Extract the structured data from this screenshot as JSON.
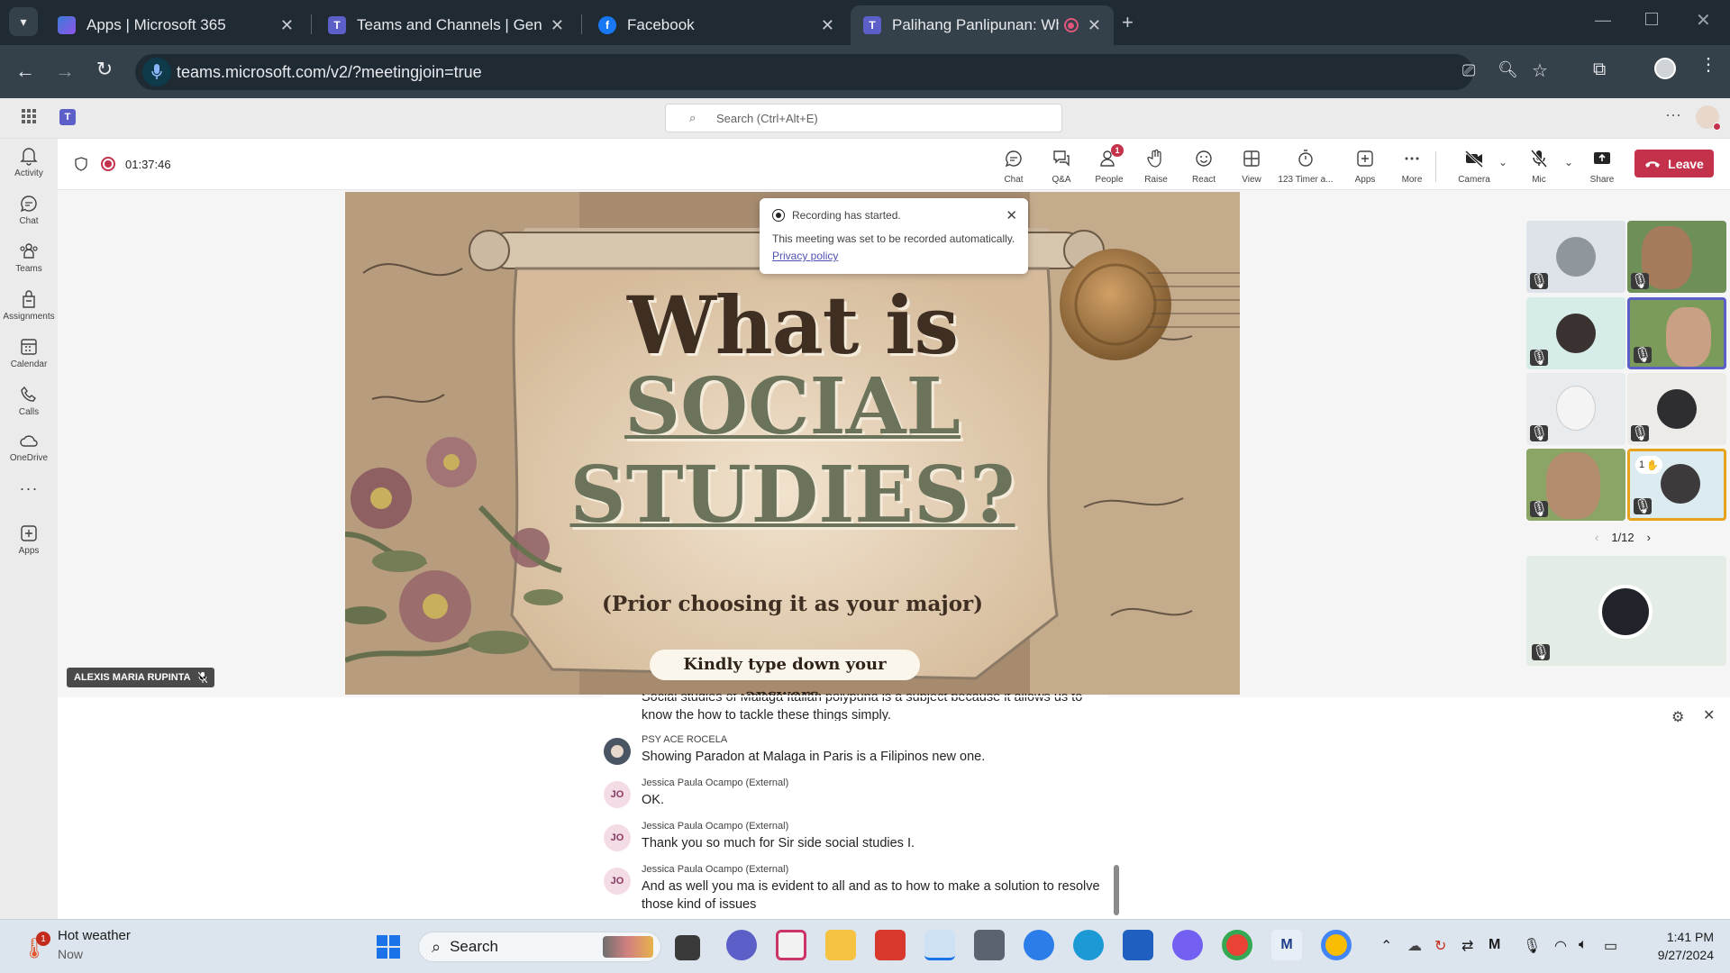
{
  "browser": {
    "tabs": [
      {
        "title": "Apps | Microsoft 365",
        "icon": "microsoft365-icon"
      },
      {
        "title": "Teams and Channels | General |",
        "icon": "teams-icon"
      },
      {
        "title": "Facebook",
        "icon": "facebook-icon"
      },
      {
        "title": "Palihang Panlipunan: Why S",
        "icon": "teams-icon"
      }
    ],
    "url": "teams.microsoft.com/v2/?meetingjoin=true"
  },
  "teams": {
    "search_placeholder": "Search (Ctrl+Alt+E)",
    "rail": [
      {
        "label": "Activity",
        "icon": "bell-icon"
      },
      {
        "label": "Chat",
        "icon": "chat-icon"
      },
      {
        "label": "Teams",
        "icon": "teams-people-icon"
      },
      {
        "label": "Assignments",
        "icon": "assignments-icon"
      },
      {
        "label": "Calendar",
        "icon": "calendar-icon"
      },
      {
        "label": "Calls",
        "icon": "phone-icon"
      },
      {
        "label": "OneDrive",
        "icon": "cloud-icon"
      },
      {
        "label": "Apps",
        "icon": "plus-square-icon"
      }
    ]
  },
  "meeting": {
    "timer": "01:37:46",
    "controls": [
      {
        "label": "Chat",
        "icon": "chat-icon"
      },
      {
        "label": "Q&A",
        "icon": "qa-icon"
      },
      {
        "label": "People",
        "icon": "people-icon",
        "badge": "1"
      },
      {
        "label": "Raise",
        "icon": "hand-icon"
      },
      {
        "label": "React",
        "icon": "smiley-icon"
      },
      {
        "label": "View",
        "icon": "grid-icon"
      },
      {
        "label": "123 Timer a...",
        "icon": "timer-icon"
      },
      {
        "label": "Apps",
        "icon": "plus-square-icon"
      },
      {
        "label": "More",
        "icon": "more-icon"
      },
      {
        "label": "Camera",
        "icon": "camera-off-icon"
      },
      {
        "label": "Mic",
        "icon": "mic-off-icon"
      },
      {
        "label": "Share",
        "icon": "share-icon"
      }
    ],
    "leave_label": "Leave",
    "toast": {
      "title": "Recording has started.",
      "body": "This meeting was set to be recorded automatically.",
      "link": "Privacy policy"
    },
    "slide": {
      "line1": "What is",
      "line2": "SOCIAL",
      "line3": "STUDIES?",
      "subtitle": "(Prior choosing it as your major)",
      "prompt": "Kindly type down your answers."
    },
    "presenter_name": "ALEXIS MARIA RUPINTA",
    "pager": "1/12",
    "raised_hand_count": "1"
  },
  "captions": [
    {
      "name": "",
      "initials": "",
      "text": "Social studies of Malaga Italian polypuna is a subject because it allows us to know the how to tackle these things simply."
    },
    {
      "name": "PSY ACE ROCELA",
      "initials": "",
      "text": "Showing Paradon at Malaga in Paris is a Filipinos new one."
    },
    {
      "name": "Jessica Paula Ocampo (External)",
      "initials": "JO",
      "text": "OK."
    },
    {
      "name": "Jessica Paula Ocampo (External)",
      "initials": "JO",
      "text": "Thank you so much for Sir side social studies I."
    },
    {
      "name": "Jessica Paula Ocampo (External)",
      "initials": "JO",
      "text": "And as well you ma is evident to all and as to how to make a solution to resolve those kind of issues"
    }
  ],
  "taskbar": {
    "weather_title": "Hot weather",
    "weather_sub": "Now",
    "weather_badge": "1",
    "search_label": "Search",
    "time": "1:41 PM",
    "date": "9/27/2024"
  },
  "colors": {
    "leave": "#c4314b",
    "teams_accent": "#5b5fc7",
    "browser_bg": "#1f2a33"
  }
}
